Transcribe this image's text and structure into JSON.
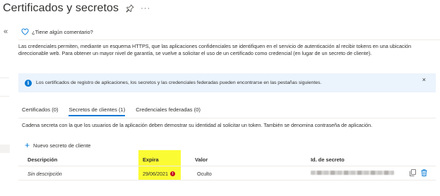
{
  "header": {
    "title": "Certificados y secretos",
    "pin_icon": "pin-icon",
    "more_label": "···"
  },
  "left_rail": {
    "collapse_label": "«"
  },
  "feedback": {
    "icon": "heart-icon",
    "text": "¿Tiene algún comentario?"
  },
  "intro": {
    "text": "Las credenciales permiten, mediante un esquema HTTPS, que las aplicaciones confidenciales se identifiquen en el servicio de autenticación al recibir tokens en una ubicación direccionable web. Para obtener un mayor nivel de garantía, se vuelve a solicitar el uso de un certificado como credencial (en lugar de un secreto de cliente)."
  },
  "infobar": {
    "icon": "info-icon",
    "icon_glyph": "i",
    "text": "Los certificados de registro de aplicaciones, los secretos y las credenciales federadas pueden encontrarse en las pestañas siguientes.",
    "close_label": "×"
  },
  "tabs": [
    {
      "label": "Certificados (0)",
      "active": false
    },
    {
      "label": "Secretos de clientes (1)",
      "active": true
    },
    {
      "label": "Credenciales federadas (0)",
      "active": false
    }
  ],
  "tab_description": "Cadena secreta con la que los usuarios de la aplicación deben demostrar su identidad al solicitar un token. También se denomina contraseña de aplicación.",
  "add_button": {
    "icon_glyph": "+",
    "label": "Nuevo secreto de cliente"
  },
  "table": {
    "columns": [
      "Descripción",
      "Expira",
      "Valor",
      "Id. de secreto"
    ],
    "rows": [
      {
        "description": "Sin descripción",
        "expires": "29/06/2021",
        "expires_warning_glyph": "!",
        "value": "Oculto",
        "secret_id_redacted": true
      }
    ]
  },
  "colors": {
    "accent": "#0078d4",
    "infobar_bg": "#ebf3fc",
    "highlight": "#fbfb34",
    "warning": "#c50f1f"
  }
}
